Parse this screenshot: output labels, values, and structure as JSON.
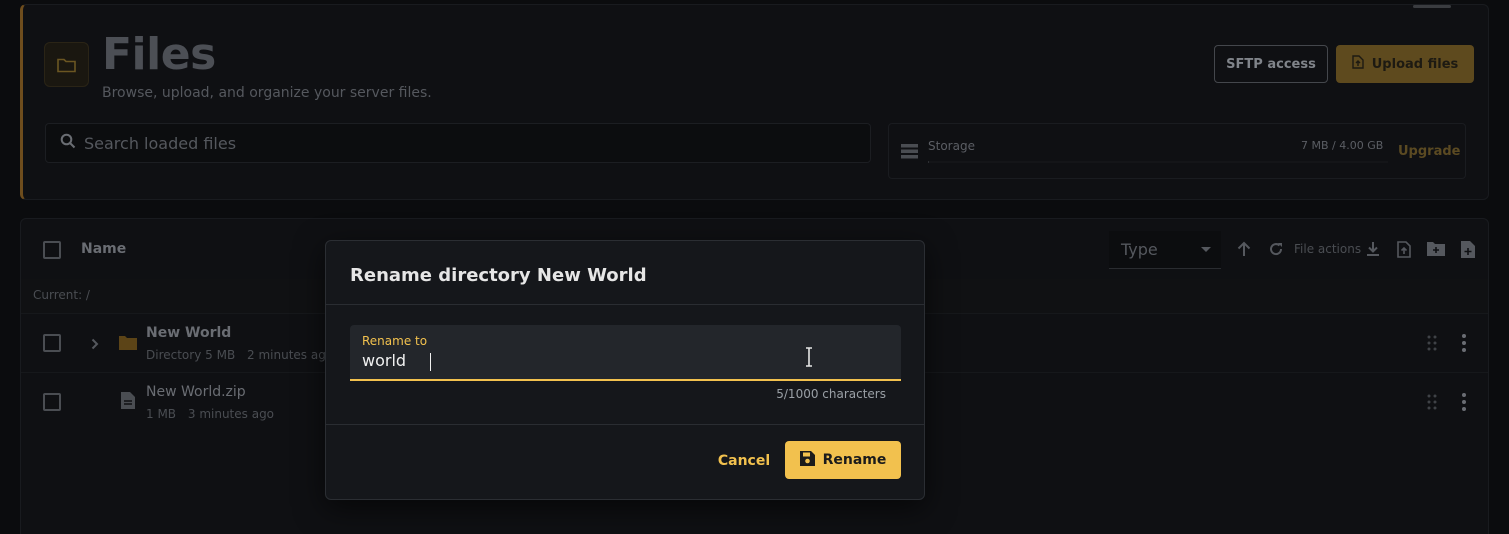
{
  "header": {
    "title": "Files",
    "subtitle": "Browse, upload, and organize your server files.",
    "sftp_label": "SFTP access",
    "upload_label": "Upload files"
  },
  "search": {
    "placeholder": "Search loaded files"
  },
  "storage": {
    "label": "Storage",
    "value": "7 MB / 4.00 GB",
    "usage_fraction": 0.002,
    "upgrade_label": "Upgrade"
  },
  "list": {
    "name_header": "Name",
    "type_select": "Type",
    "file_actions_label": "File actions",
    "current_path": "Current: /",
    "rows": [
      {
        "name": "New World",
        "kind": "Directory",
        "size": "5 MB",
        "time": "2 minutes ago"
      },
      {
        "name": "New World.zip",
        "kind": "",
        "size": "1 MB",
        "time": "3 minutes ago"
      }
    ]
  },
  "dialog": {
    "title": "Rename directory New World",
    "field_label": "Rename to",
    "field_value": "world",
    "counter": "5/1000 characters",
    "cancel_label": "Cancel",
    "rename_label": "Rename"
  },
  "colors": {
    "accent": "#f2c14e",
    "background": "#0b0c0e",
    "dialog_bg": "#15171b"
  },
  "icons": [
    "folder-icon",
    "search-icon",
    "storage-icon",
    "upload-icon",
    "sort-up-icon",
    "refresh-icon",
    "download-icon",
    "upload-file-icon",
    "new-folder-icon",
    "new-file-icon",
    "chevron-right-icon",
    "file-icon",
    "drag-handle-icon",
    "more-vert-icon",
    "save-icon",
    "text-cursor-icon"
  ]
}
